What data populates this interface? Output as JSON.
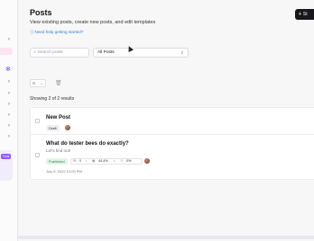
{
  "sidebar": {
    "chevrons": [
      "‹",
      "›",
      "›",
      "›",
      "›",
      "›",
      "›"
    ],
    "trial_badge": "Trial"
  },
  "header": {
    "title": "Posts",
    "subtitle": "View existing posts, create new posts, and edit templates",
    "help_link": "Need help getting started?",
    "new_button_label": "St"
  },
  "filters": {
    "search_placeholder": "Search posts",
    "select_value": "All Posts"
  },
  "results_count": "Showing 2 of 2 results",
  "posts": [
    {
      "title": "New Post",
      "status": "Draft"
    },
    {
      "title": "What do tester bees do exactly?",
      "subtitle": "Let's find out!",
      "status": "Published",
      "stats": {
        "a": "0",
        "b": "44.4%",
        "c": "0%"
      },
      "date": "July 6, 2022 12:00 PM"
    }
  ],
  "colors": {
    "accent_dark": "#17171c",
    "link": "#3b7bd6",
    "published": "#2f8a46"
  }
}
